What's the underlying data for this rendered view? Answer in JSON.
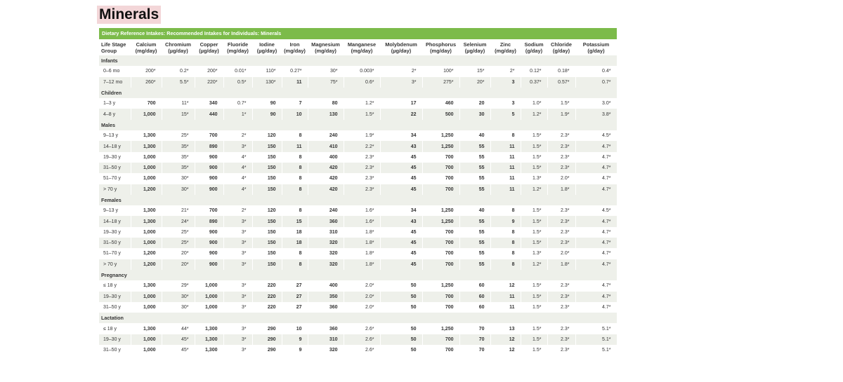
{
  "page_title": "Minerals",
  "table": {
    "title": "Dietary Reference Intakes: Recommended Intakes for Individuals: Minerals",
    "headers": [
      [
        "Life Stage",
        "Group"
      ],
      [
        "Calcium",
        "(mg/day)"
      ],
      [
        "Chromium",
        "(µg/day)"
      ],
      [
        "Copper",
        "(µg/day)"
      ],
      [
        "Fluoride",
        "(mg/day)"
      ],
      [
        "Iodine",
        "(µg/day)"
      ],
      [
        "Iron",
        "(mg/day)"
      ],
      [
        "Magnesium",
        "(mg/day)"
      ],
      [
        "Manganese",
        "(mg/day)"
      ],
      [
        "Molybdenum",
        "(µg/day)"
      ],
      [
        "Phosphorus",
        "(mg/day)"
      ],
      [
        "Selenium",
        "(µg/day)"
      ],
      [
        "Zinc",
        "(mg/day)"
      ],
      [
        "Sodium",
        "(g/day)"
      ],
      [
        "Chloride",
        "(g/day)"
      ],
      [
        "Potassium",
        "(g/day)"
      ]
    ],
    "groups": [
      {
        "label": "Infants",
        "rows": [
          [
            "0–6 mo",
            "200*",
            "0.2*",
            "200*",
            "0.01*",
            "110*",
            "0.27*",
            "30*",
            "0.003*",
            "2*",
            "100*",
            "15*",
            "2*",
            "0.12*",
            "0.18*",
            "0.4*"
          ],
          [
            "7–12 mo",
            "260*",
            "5.5*",
            "220*",
            "0.5*",
            "130*",
            "11",
            "75*",
            "0.6*",
            "3*",
            "275*",
            "20*",
            "3",
            "0.37*",
            "0.57*",
            "0.7*"
          ]
        ]
      },
      {
        "label": "Children",
        "rows": [
          [
            "1–3 y",
            "700",
            "11*",
            "340",
            "0.7*",
            "90",
            "7",
            "80",
            "1.2*",
            "17",
            "460",
            "20",
            "3",
            "1.0*",
            "1.5*",
            "3.0*"
          ],
          [
            "4–8 y",
            "1,000",
            "15*",
            "440",
            "1*",
            "90",
            "10",
            "130",
            "1.5*",
            "22",
            "500",
            "30",
            "5",
            "1.2*",
            "1.9*",
            "3.8*"
          ]
        ]
      },
      {
        "label": "Males",
        "rows": [
          [
            "9–13 y",
            "1,300",
            "25*",
            "700",
            "2*",
            "120",
            "8",
            "240",
            "1.9*",
            "34",
            "1,250",
            "40",
            "8",
            "1.5*",
            "2.3*",
            "4.5*"
          ],
          [
            "14–18 y",
            "1,300",
            "35*",
            "890",
            "3*",
            "150",
            "11",
            "410",
            "2.2*",
            "43",
            "1,250",
            "55",
            "11",
            "1.5*",
            "2.3*",
            "4.7*"
          ],
          [
            "19–30 y",
            "1,000",
            "35*",
            "900",
            "4*",
            "150",
            "8",
            "400",
            "2.3*",
            "45",
            "700",
            "55",
            "11",
            "1.5*",
            "2.3*",
            "4.7*"
          ],
          [
            "31–50 y",
            "1,000",
            "35*",
            "900",
            "4*",
            "150",
            "8",
            "420",
            "2.3*",
            "45",
            "700",
            "55",
            "11",
            "1.5*",
            "2.3*",
            "4.7*"
          ],
          [
            "51–70 y",
            "1,000",
            "30*",
            "900",
            "4*",
            "150",
            "8",
            "420",
            "2.3*",
            "45",
            "700",
            "55",
            "11",
            "1.3*",
            "2.0*",
            "4.7*"
          ],
          [
            "> 70 y",
            "1,200",
            "30*",
            "900",
            "4*",
            "150",
            "8",
            "420",
            "2.3*",
            "45",
            "700",
            "55",
            "11",
            "1.2*",
            "1.8*",
            "4.7*"
          ]
        ]
      },
      {
        "label": "Females",
        "rows": [
          [
            "9–13 y",
            "1,300",
            "21*",
            "700",
            "2*",
            "120",
            "8",
            "240",
            "1.6*",
            "34",
            "1,250",
            "40",
            "8",
            "1.5*",
            "2.3*",
            "4.5*"
          ],
          [
            "14–18 y",
            "1,300",
            "24*",
            "890",
            "3*",
            "150",
            "15",
            "360",
            "1.6*",
            "43",
            "1,250",
            "55",
            "9",
            "1.5*",
            "2.3*",
            "4.7*"
          ],
          [
            "19–30 y",
            "1,000",
            "25*",
            "900",
            "3*",
            "150",
            "18",
            "310",
            "1.8*",
            "45",
            "700",
            "55",
            "8",
            "1.5*",
            "2.3*",
            "4.7*"
          ],
          [
            "31–50 y",
            "1,000",
            "25*",
            "900",
            "3*",
            "150",
            "18",
            "320",
            "1.8*",
            "45",
            "700",
            "55",
            "8",
            "1.5*",
            "2.3*",
            "4.7*"
          ],
          [
            "51–70 y",
            "1,200",
            "20*",
            "900",
            "3*",
            "150",
            "8",
            "320",
            "1.8*",
            "45",
            "700",
            "55",
            "8",
            "1.3*",
            "2.0*",
            "4.7*"
          ],
          [
            "> 70 y",
            "1,200",
            "20*",
            "900",
            "3*",
            "150",
            "8",
            "320",
            "1.8*",
            "45",
            "700",
            "55",
            "8",
            "1.2*",
            "1.8*",
            "4.7*"
          ]
        ]
      },
      {
        "label": "Pregnancy",
        "rows": [
          [
            "≤ 18 y",
            "1,300",
            "29*",
            "1,000",
            "3*",
            "220",
            "27",
            "400",
            "2.0*",
            "50",
            "1,250",
            "60",
            "12",
            "1.5*",
            "2.3*",
            "4.7*"
          ],
          [
            "19–30 y",
            "1,000",
            "30*",
            "1,000",
            "3*",
            "220",
            "27",
            "350",
            "2.0*",
            "50",
            "700",
            "60",
            "11",
            "1.5*",
            "2.3*",
            "4.7*"
          ],
          [
            "31–50 y",
            "1,000",
            "30*",
            "1,000",
            "3*",
            "220",
            "27",
            "360",
            "2.0*",
            "50",
            "700",
            "60",
            "11",
            "1.5*",
            "2.3*",
            "4.7*"
          ]
        ]
      },
      {
        "label": "Lactation",
        "rows": [
          [
            "≤ 18 y",
            "1,300",
            "44*",
            "1,300",
            "3*",
            "290",
            "10",
            "360",
            "2.6*",
            "50",
            "1,250",
            "70",
            "13",
            "1.5*",
            "2.3*",
            "5.1*"
          ],
          [
            "19–30 y",
            "1,000",
            "45*",
            "1,300",
            "3*",
            "290",
            "9",
            "310",
            "2.6*",
            "50",
            "700",
            "70",
            "12",
            "1.5*",
            "2.3*",
            "5.1*"
          ],
          [
            "31–50 y",
            "1,000",
            "45*",
            "1,300",
            "3*",
            "290",
            "9",
            "320",
            "2.6*",
            "50",
            "700",
            "70",
            "12",
            "1.5*",
            "2.3*",
            "5.1*"
          ]
        ]
      }
    ],
    "colors": {
      "banner": "#7cbb4a",
      "shaded_row": "#eef0ea",
      "title_highlight": "#f3d6d8"
    }
  }
}
